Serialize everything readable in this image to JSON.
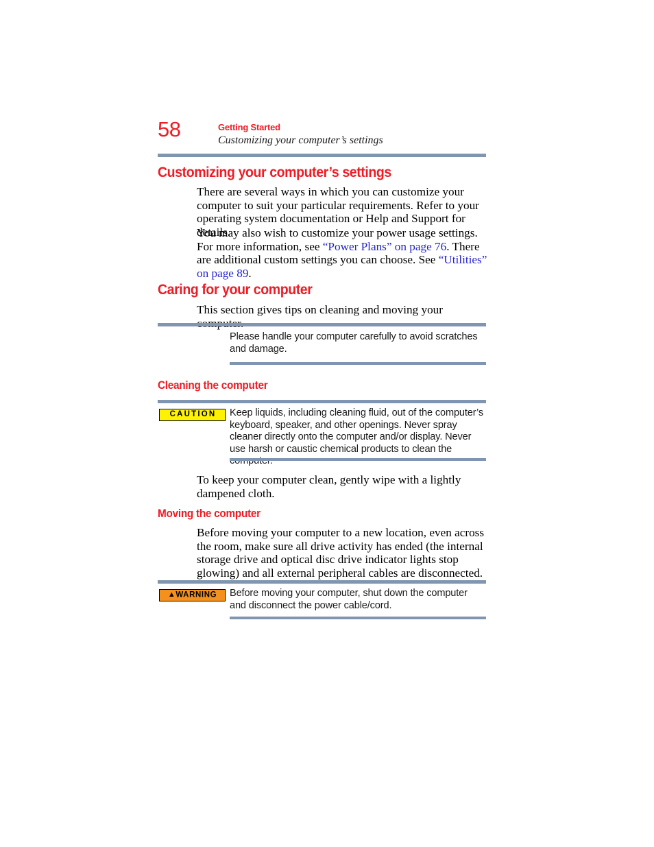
{
  "page": {
    "number": "58",
    "chapter": "Getting Started",
    "running_section": "Customizing your computer’s settings",
    "rule_color": "#8095b0",
    "heading_color": "#ee1c25",
    "link_color": "#2323cc"
  },
  "sections": {
    "customizing": {
      "heading": "Customizing your computer’s settings",
      "paragraph_1": "There are several ways in which you can customize your computer to suit your particular requirements. Refer to your operating system documentation or Help and Support for details.",
      "paragraph_2_part_1": "You may also wish to customize your power usage settings. For more information, see ",
      "paragraph_2_link_1": "“Power Plans” on page 76",
      "paragraph_2_part_2": ". There are additional custom settings you can choose. See ",
      "paragraph_2_link_2": "“Utilities” on page 89",
      "paragraph_2_part_3": "."
    },
    "caring": {
      "heading": "Caring for your computer",
      "paragraph_1": "This section gives tips on cleaning and moving your computer.",
      "note": {
        "text": "Please handle your computer carefully to avoid scratches and damage."
      }
    },
    "cleaning": {
      "heading": "Cleaning the computer",
      "caution": {
        "badge_label": "CAUTION",
        "badge_bg": "#fff200",
        "text": "Keep liquids, including cleaning fluid, out of the computer’s keyboard, speaker, and other openings. Never spray cleaner directly onto the computer and/or display. Never use harsh or caustic chemical products to clean the computer."
      },
      "paragraph_1": "To keep your computer clean, gently wipe with a lightly dampened cloth."
    },
    "moving": {
      "heading": "Moving the computer",
      "paragraph_1": "Before moving your computer to a new location, even across the room, make sure all drive activity has ended (the internal storage drive and optical disc drive indicator lights stop glowing) and all external peripheral cables are disconnected.",
      "warning": {
        "badge_triangle": "▲",
        "badge_label": "WARNING",
        "badge_bg": "#f4901e",
        "text": "Before moving your computer, shut down the computer and disconnect the power cable/cord."
      }
    }
  }
}
